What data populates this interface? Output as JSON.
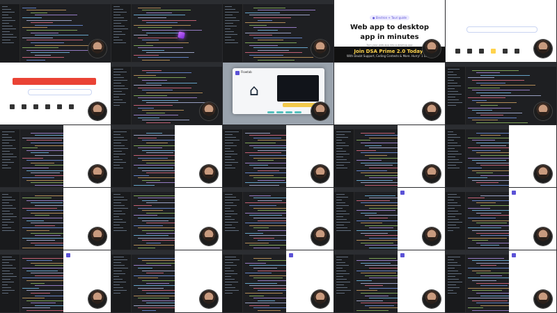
{
  "grid": {
    "rows": [
      [
        {
          "kind": "editor",
          "preview": false
        },
        {
          "kind": "editor-purple",
          "preview": false
        },
        {
          "kind": "editor",
          "preview": false
        },
        {
          "kind": "banner",
          "preview": false
        },
        {
          "kind": "search",
          "preview": false
        }
      ],
      [
        {
          "kind": "search-wide",
          "preview": false
        },
        {
          "kind": "editor",
          "preview": false
        },
        {
          "kind": "appwindow",
          "preview": false
        },
        {
          "kind": "blank",
          "preview": false
        },
        {
          "kind": "editor-only",
          "preview": false
        }
      ],
      [
        {
          "kind": "editor",
          "preview": true
        },
        {
          "kind": "editor",
          "preview": true
        },
        {
          "kind": "editor",
          "preview": true
        },
        {
          "kind": "editor",
          "preview": true
        },
        {
          "kind": "editor",
          "preview": true
        }
      ],
      [
        {
          "kind": "editor",
          "preview": true
        },
        {
          "kind": "editor",
          "preview": true
        },
        {
          "kind": "editor",
          "preview": true
        },
        {
          "kind": "editor",
          "preview": true,
          "previewLogo": true
        },
        {
          "kind": "editor",
          "preview": true,
          "previewLogo": true
        }
      ],
      [
        {
          "kind": "editor",
          "preview": true,
          "previewLogo": true
        },
        {
          "kind": "editor",
          "preview": true
        },
        {
          "kind": "editor",
          "preview": true,
          "previewLogo": true
        },
        {
          "kind": "editor",
          "preview": true,
          "previewLogo": true
        },
        {
          "kind": "editor",
          "preview": true,
          "previewLogo": true
        }
      ]
    ]
  },
  "banner": {
    "pill": "● Electron + Tauri guide",
    "title_line1": "Web app to desktop",
    "title_line2": "app in minutes",
    "subtitle": "Turn your web app into a desktop app",
    "promo_title": "Join DSA Prime 2.0 Today!",
    "promo_sub": "With Doubt Support, Coding Contests & More. Hurry! 1 Left →"
  },
  "appwindow": {
    "title": "Flowtab"
  },
  "colors": {
    "editor_bg": "#1e1f22",
    "accent_red": "#ea4335",
    "accent_yellow": "#ffd34d",
    "accent_purple": "#5b52d6"
  }
}
